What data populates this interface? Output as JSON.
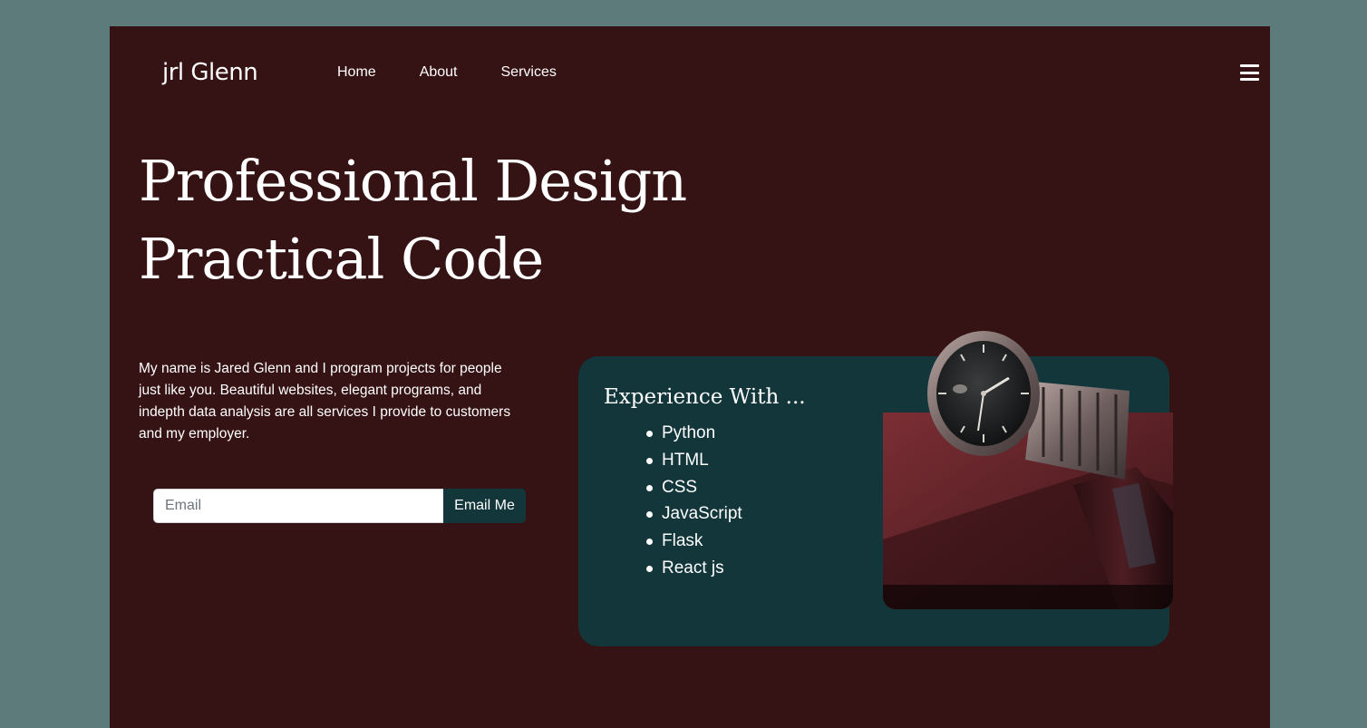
{
  "header": {
    "logo": "jrl Glenn",
    "nav": [
      "Home",
      "About",
      "Services"
    ],
    "menu_icon": "hamburger-menu-icon"
  },
  "hero": {
    "title_line1": "Professional Design",
    "title_line2": "Practical Code"
  },
  "intro": {
    "text": "My name is Jared Glenn and I program projects for people just like you. Beautiful websites, elegant programs, and indepth data analysis are all services I provide to customers and my employer."
  },
  "signup": {
    "email_placeholder": "Email",
    "email_value": "",
    "button_label": "Email Me"
  },
  "experience": {
    "title": "Experience With ...",
    "items": [
      "Python",
      "HTML",
      "CSS",
      "JavaScript",
      "Flask",
      "React js"
    ]
  },
  "colors": {
    "page_bg": "#5d7b7b",
    "content_bg": "#351213",
    "card_bg": "#12363a",
    "accent": "#12363a"
  }
}
